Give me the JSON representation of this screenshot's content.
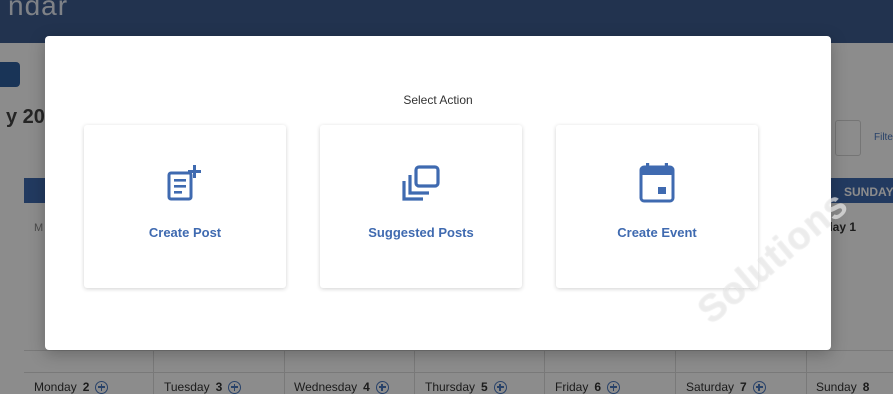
{
  "app": {
    "title": "ndar",
    "month_label": "y 20",
    "filter_label": "Filte",
    "sunday_header": "SUNDAY",
    "week_row1_label": "M",
    "sunday_row1": "nday  1",
    "week_row2": [
      {
        "day": "Monday",
        "num": "2"
      },
      {
        "day": "Tuesday",
        "num": "3"
      },
      {
        "day": "Wednesday",
        "num": "4"
      },
      {
        "day": "Thursday",
        "num": "5"
      },
      {
        "day": "Friday",
        "num": "6"
      },
      {
        "day": "Saturday",
        "num": "7"
      },
      {
        "day": "Sunday",
        "num": "8"
      }
    ]
  },
  "modal": {
    "title": "Select Action",
    "cards": [
      {
        "label": "Create Post",
        "icon": "create-post-icon"
      },
      {
        "label": "Suggested Posts",
        "icon": "suggested-posts-icon"
      },
      {
        "label": "Create Event",
        "icon": "calendar-event-icon"
      }
    ]
  },
  "watermark": "Solutions",
  "colors": {
    "accent": "#3f6ab0",
    "topbar": "#3f5e91"
  }
}
